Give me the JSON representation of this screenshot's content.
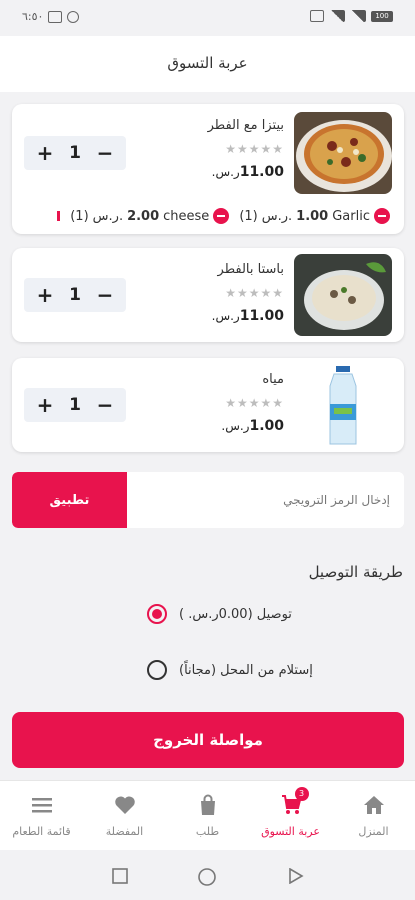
{
  "status_bar": {
    "time": "٦:٥٠",
    "battery": "100"
  },
  "header": {
    "title": "عربة التسوق"
  },
  "cart_items": [
    {
      "name": "بيتزا مع الفطر",
      "stars": "★★★★★",
      "price_value": "11.00",
      "currency": "ر.س.",
      "quantity": "1",
      "addons": [
        {
          "name": "Garlic",
          "price_value": "1.00",
          "currency": "ر.س.",
          "count": "(1)"
        },
        {
          "name": "cheese",
          "price_value": "2.00",
          "currency": "ر.س.",
          "count": "(1)"
        }
      ]
    },
    {
      "name": "باستا بالفطر",
      "stars": "★★★★★",
      "price_value": "11.00",
      "currency": "ر.س.",
      "quantity": "1"
    },
    {
      "name": "مياه",
      "stars": "★★★★★",
      "price_value": "1.00",
      "currency": "ر.س.",
      "quantity": "1"
    }
  ],
  "coupon": {
    "placeholder": "إدخال الرمز الترويجي",
    "apply_label": "تطبيق"
  },
  "delivery": {
    "title": "طريقة التوصيل",
    "options": [
      {
        "label": "توصيل (0.00ر.س. )",
        "selected": true
      },
      {
        "label": "إستلام من المحل (مجاناً)",
        "selected": false
      }
    ]
  },
  "checkout_label": "مواصلة الخروج",
  "bottom_nav": [
    {
      "label": "المنزل",
      "icon": "home-icon"
    },
    {
      "label": "عربة التسوق",
      "icon": "cart-icon",
      "badge": "3",
      "active": true
    },
    {
      "label": "طلب",
      "icon": "bag-icon"
    },
    {
      "label": "المفضلة",
      "icon": "heart-icon"
    },
    {
      "label": "قائمة الطعام",
      "icon": "menu-icon"
    }
  ],
  "colors": {
    "accent": "#e8134d",
    "background": "#f2f2f4",
    "card": "#ffffff",
    "stepper": "#eef1f6"
  }
}
